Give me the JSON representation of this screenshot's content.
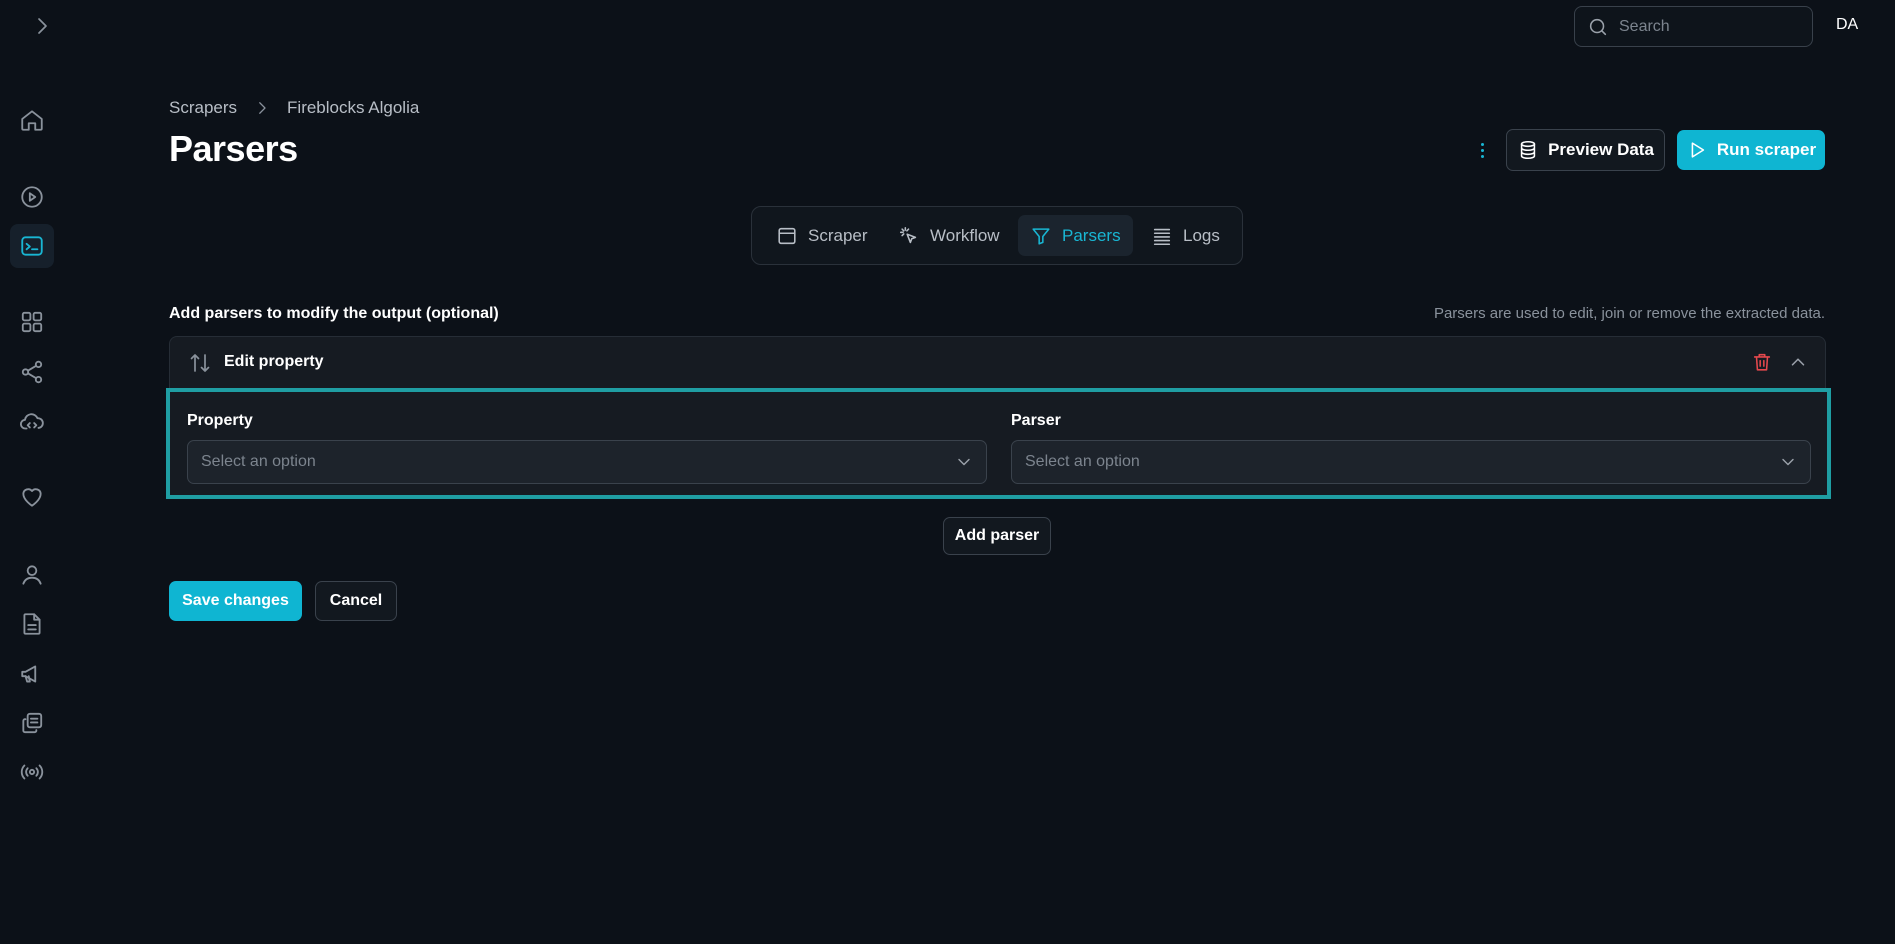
{
  "search": {
    "placeholder": "Search"
  },
  "user": {
    "initials": "DA"
  },
  "sidebar": {
    "items": [
      {
        "icon": "home-icon"
      },
      {
        "icon": "play-circle-icon"
      },
      {
        "icon": "terminal-icon",
        "active": true
      },
      {
        "icon": "grid-icon"
      },
      {
        "icon": "share-icon"
      },
      {
        "icon": "cloud-code-icon"
      },
      {
        "icon": "heart-icon"
      },
      {
        "icon": "user-icon"
      },
      {
        "icon": "document-icon"
      },
      {
        "icon": "megaphone-icon"
      },
      {
        "icon": "copy-icon"
      },
      {
        "icon": "broadcast-icon"
      }
    ]
  },
  "breadcrumb": {
    "items": [
      "Scrapers",
      "Fireblocks Algolia"
    ]
  },
  "page": {
    "title": "Parsers"
  },
  "actions": {
    "preview": "Preview Data",
    "run": "Run scraper"
  },
  "tabs": [
    {
      "label": "Scraper",
      "icon": "window-icon"
    },
    {
      "label": "Workflow",
      "icon": "cursor-click-icon"
    },
    {
      "label": "Parsers",
      "icon": "filter-icon",
      "active": true
    },
    {
      "label": "Logs",
      "icon": "list-icon"
    }
  ],
  "section": {
    "label": "Add parsers to modify the output (optional)",
    "hint": "Parsers are used to edit, join or remove the extracted data."
  },
  "parser": {
    "title": "Edit property",
    "property_label": "Property",
    "property_placeholder": "Select an option",
    "parser_label": "Parser",
    "parser_placeholder": "Select an option"
  },
  "buttons": {
    "add_parser": "Add parser",
    "save": "Save changes",
    "cancel": "Cancel"
  },
  "colors": {
    "accent": "#0fb5d2",
    "focus_border": "#1f9ea3",
    "danger": "#e5484d",
    "background": "#0c1118"
  }
}
